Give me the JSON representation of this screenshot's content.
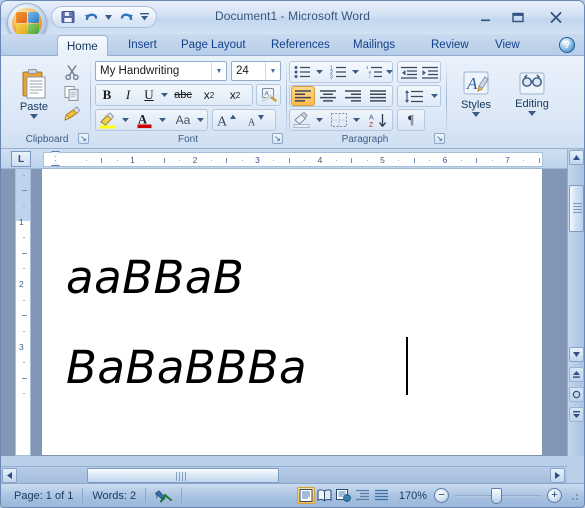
{
  "window": {
    "title": "Document1 - Microsoft Word",
    "minimize_label": "–",
    "maximize_label": "❐",
    "close_label": "✕"
  },
  "office_button": {
    "name": "Office Button"
  },
  "quick_access": {
    "items": [
      {
        "icon": "save-icon",
        "label": "Save"
      },
      {
        "icon": "undo-icon",
        "label": "Undo"
      },
      {
        "icon": "undo-dropdown-icon",
        "label": "Undo options"
      },
      {
        "icon": "redo-icon",
        "label": "Redo"
      },
      {
        "icon": "customize-qat-icon",
        "label": "Customize Quick Access Toolbar"
      }
    ]
  },
  "tabs": {
    "items": [
      {
        "label": "Home",
        "active": true
      },
      {
        "label": "Insert",
        "active": false
      },
      {
        "label": "Page Layout",
        "active": false
      },
      {
        "label": "References",
        "active": false
      },
      {
        "label": "Mailings",
        "active": false
      },
      {
        "label": "Review",
        "active": false
      },
      {
        "label": "View",
        "active": false
      }
    ],
    "help_label": "?"
  },
  "ribbon": {
    "groups": [
      {
        "name": "clipboard",
        "label": "Clipboard",
        "paste_label": "Paste",
        "buttons": [
          {
            "icon": "cut-icon",
            "label": "Cut"
          },
          {
            "icon": "copy-icon",
            "label": "Copy"
          },
          {
            "icon": "format-painter-icon",
            "label": "Format Painter"
          }
        ]
      },
      {
        "name": "font",
        "label": "Font",
        "font_name": "My Handwriting",
        "font_size": "24",
        "buttons": [
          {
            "icon": "bold-icon",
            "label": "B"
          },
          {
            "icon": "italic-icon",
            "label": "I"
          },
          {
            "icon": "underline-icon",
            "label": "U"
          },
          {
            "icon": "strikethrough-icon",
            "label": "abc"
          },
          {
            "icon": "subscript-icon",
            "label": "x₂"
          },
          {
            "icon": "superscript-icon",
            "label": "x²"
          },
          {
            "icon": "clear-formatting-icon",
            "label": "Clear Formatting"
          },
          {
            "icon": "text-highlight-color-icon",
            "label": "Text Highlight Color"
          },
          {
            "icon": "font-color-icon",
            "label": "Font Color"
          },
          {
            "icon": "change-case-icon",
            "label": "Aa"
          },
          {
            "icon": "grow-font-icon",
            "label": "A"
          },
          {
            "icon": "shrink-font-icon",
            "label": "A"
          }
        ]
      },
      {
        "name": "paragraph",
        "label": "Paragraph",
        "buttons": [
          {
            "icon": "bullets-icon",
            "label": "Bullets"
          },
          {
            "icon": "numbering-icon",
            "label": "Numbering"
          },
          {
            "icon": "multilevel-list-icon",
            "label": "Multilevel List"
          },
          {
            "icon": "decrease-indent-icon",
            "label": "Decrease Indent"
          },
          {
            "icon": "increase-indent-icon",
            "label": "Increase Indent"
          },
          {
            "icon": "align-left-icon",
            "label": "Align Text Left"
          },
          {
            "icon": "align-center-icon",
            "label": "Center"
          },
          {
            "icon": "align-right-icon",
            "label": "Align Text Right"
          },
          {
            "icon": "justify-icon",
            "label": "Justify"
          },
          {
            "icon": "line-spacing-icon",
            "label": "Line Spacing"
          },
          {
            "icon": "shading-icon",
            "label": "Shading"
          },
          {
            "icon": "borders-icon",
            "label": "Borders"
          },
          {
            "icon": "sort-icon",
            "label": "Sort"
          },
          {
            "icon": "show-formatting-marks-icon",
            "label": "¶"
          }
        ]
      },
      {
        "name": "styles",
        "label": "Styles",
        "icon": "styles-icon"
      },
      {
        "name": "editing",
        "label": "Editing",
        "icon": "editing-icon"
      }
    ]
  },
  "ruler": {
    "tab_selector_label": "L",
    "horizontal_numbers": [
      "1",
      "2",
      "3",
      "4",
      "5",
      "6",
      "7"
    ],
    "vertical_numbers": [
      "1",
      "2",
      "3"
    ]
  },
  "document": {
    "line1": "aaBBaB",
    "line2": "BaBaBBBa",
    "font": "My Handwriting",
    "size": "24"
  },
  "scrollbars": {
    "v_up_label": "▲",
    "v_down_label": "▼",
    "prev_page_label": "⤒",
    "select_browse_label": "●",
    "next_page_label": "⤓",
    "h_left_label": "◀",
    "h_right_label": "▶"
  },
  "status_bar": {
    "page": "Page: 1 of 1",
    "words": "Words: 2",
    "proofing_icon": "spell-check-icon",
    "views": [
      {
        "icon": "print-layout-view-icon",
        "label": "Print Layout",
        "active": true
      },
      {
        "icon": "full-screen-reading-view-icon",
        "label": "Full Screen Reading",
        "active": false
      },
      {
        "icon": "web-layout-view-icon",
        "label": "Web Layout",
        "active": false
      },
      {
        "icon": "outline-view-icon",
        "label": "Outline",
        "active": false
      },
      {
        "icon": "draft-view-icon",
        "label": "Draft",
        "active": false
      }
    ],
    "zoom_value": "170%",
    "zoom_out_label": "−",
    "zoom_in_label": "+"
  },
  "colors": {
    "accent": "#15355e",
    "ribbon_bg": "#dfeaf7",
    "title_text": "#36567e",
    "highlight_yellow": "#ffff00",
    "font_color_red": "#cc0000"
  }
}
